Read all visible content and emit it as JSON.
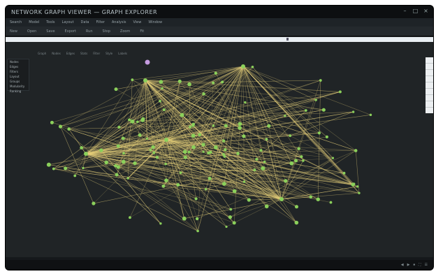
{
  "window": {
    "title": "NETWORK GRAPH VIEWER — GRAPH EXPLORER"
  },
  "menu": [
    "Search",
    "Model",
    "Tools",
    "Layout",
    "Data",
    "Filter",
    "Analysis",
    "View",
    "Window"
  ],
  "toolbar": [
    "New",
    "Open",
    "Save",
    "Export",
    "Run",
    "Stop",
    "Zoom",
    "Fit"
  ],
  "subtabs": [
    "Graph",
    "Nodes",
    "Edges",
    "Stats",
    "Filter",
    "Style",
    "Labels"
  ],
  "left_panel": [
    "Nodes",
    "Edges",
    "Filters",
    "Layout",
    "Groups",
    "Modularity",
    "Ranking"
  ],
  "colors": {
    "edge": "#e7d27b",
    "node": "#8bd05b",
    "node_highlight": "#c59ce0",
    "background": "#202426"
  },
  "status": [
    "◀",
    "▶",
    "⏹",
    "⛶",
    "☰"
  ]
}
